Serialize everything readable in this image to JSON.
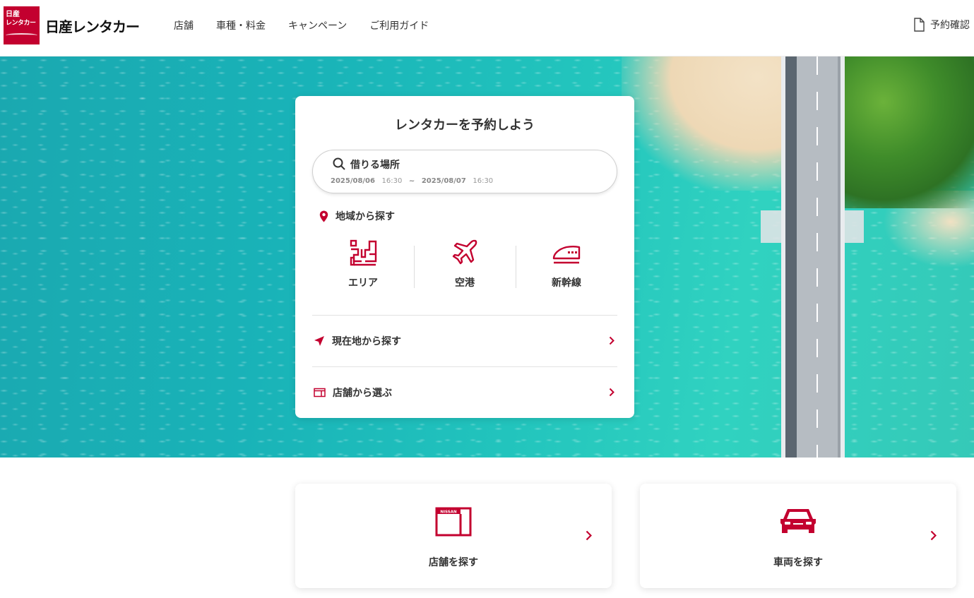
{
  "header": {
    "logo_line1": "日産",
    "logo_line2": "レンタカー",
    "brand_name": "日産レンタカー",
    "nav": [
      "店舗",
      "車種・料金",
      "キャンペーン",
      "ご利用ガイド"
    ],
    "reservation_check": "予約確認"
  },
  "search_card": {
    "title": "レンタカーを予約しよう",
    "place_placeholder": "借りる場所",
    "pickup_date": "2025/08/06",
    "pickup_time": "16:30",
    "date_separator": "~",
    "return_date": "2025/08/07",
    "return_time": "16:30",
    "region_label": "地域から探す",
    "categories": [
      {
        "label": "エリア",
        "icon": "area-icon"
      },
      {
        "label": "空港",
        "icon": "airplane-icon"
      },
      {
        "label": "新幹線",
        "icon": "bullet-train-icon"
      }
    ],
    "current_location_label": "現在地から探す",
    "store_select_label": "店舗から選ぶ"
  },
  "bottom_cards": {
    "store_search_label": "店舗を探す",
    "store_icon_text": "NISSAN",
    "vehicle_search_label": "車両を探す"
  },
  "colors": {
    "accent": "#c3002f",
    "text": "#333333"
  }
}
